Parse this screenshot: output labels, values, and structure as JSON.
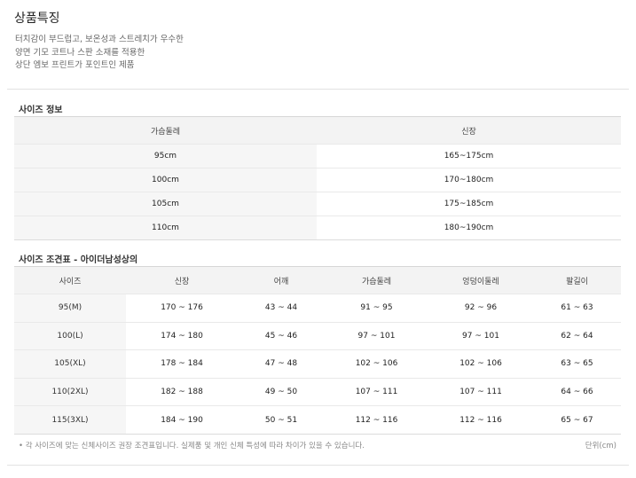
{
  "features": {
    "title": "상품특징",
    "lines": [
      "터치감이 부드럽고, 보온성과 스트레치가 우수한",
      "양면 기모 코트나 스판 소재를 적용한",
      "상단 엠보 프린트가 포인트인 제품"
    ]
  },
  "size_info": {
    "title": "사이즈 정보",
    "headers": [
      "가슴둘레",
      "신장"
    ],
    "rows": [
      [
        "95cm",
        "165~175cm"
      ],
      [
        "100cm",
        "170~180cm"
      ],
      [
        "105cm",
        "175~185cm"
      ],
      [
        "110cm",
        "180~190cm"
      ]
    ]
  },
  "size_chart": {
    "title": "사이즈 조견표 - 아이더남성상의",
    "headers": [
      "사이즈",
      "신장",
      "어깨",
      "가슴둘레",
      "엉덩이둘레",
      "팔길이"
    ],
    "rows": [
      [
        "95(M)",
        "170 ~ 176",
        "43 ~ 44",
        "91 ~ 95",
        "92 ~ 96",
        "61 ~ 63"
      ],
      [
        "100(L)",
        "174 ~ 180",
        "45 ~ 46",
        "97 ~ 101",
        "97 ~ 101",
        "62 ~ 64"
      ],
      [
        "105(XL)",
        "178 ~ 184",
        "47 ~ 48",
        "102 ~ 106",
        "102 ~ 106",
        "63 ~ 65"
      ],
      [
        "110(2XL)",
        "182 ~ 188",
        "49 ~ 50",
        "107 ~ 111",
        "107 ~ 111",
        "64 ~ 66"
      ],
      [
        "115(3XL)",
        "184 ~ 190",
        "50 ~ 51",
        "112 ~ 116",
        "112 ~ 116",
        "65 ~ 67"
      ]
    ]
  },
  "footnote": "• 각 사이즈에 맞는 신체사이즈 권장 조견표입니다. 실제품 및 개인 신체 특성에 따라 차이가 있을 수 있습니다.",
  "unit": "단위(cm)"
}
